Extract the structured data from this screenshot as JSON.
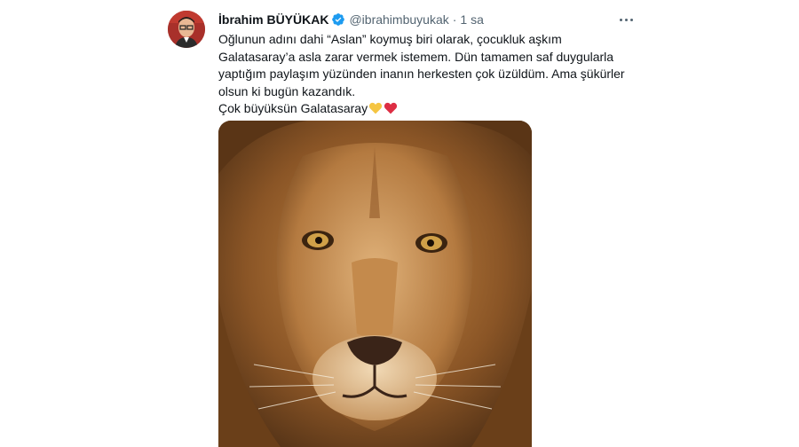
{
  "tweet": {
    "author_name": "İbrahim BÜYÜKAK",
    "handle": "@ibrahimbuyukak",
    "separator": "·",
    "time": "1 sa",
    "text_lines": [
      "Oğlunun adını dahi “Aslan” koymuş biri olarak, çocukluk aşkım",
      "Galatasaray’a asla zarar vermek istemem. Dün tamamen saf duygularla",
      "yaptığım paylaşım yüzünden inanın herkesten çok üzüldüm. Ama şükürler",
      "olsun ki bugün kazandık.",
      "Çok büyüksün Galatasaray"
    ],
    "emoji": [
      "yellow-heart",
      "red-heart"
    ],
    "colors": {
      "verified": "#1d9bf0",
      "muted": "#536471",
      "yellow_heart": "#f5c542",
      "red_heart": "#dd2e44"
    }
  }
}
